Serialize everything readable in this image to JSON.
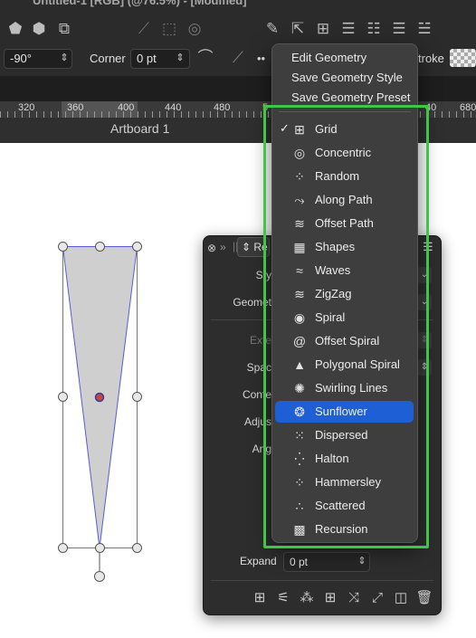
{
  "window": {
    "title": "Untitled-1 [RGB] (@76.5%) - [Modified]"
  },
  "toolbar": {
    "angle_value": "-90°",
    "corner_label": "Corner",
    "corner_value": "0 pt",
    "stroke_label": "troke",
    "more_label": "••"
  },
  "ruler": {
    "ticks": [
      "320",
      "360",
      "400",
      "440",
      "480",
      "5",
      "40",
      "680"
    ]
  },
  "artboard": {
    "label": "Artboard 1"
  },
  "menu": {
    "top_items": [
      "Edit Geometry",
      "Save Geometry Style",
      "Save Geometry Preset"
    ],
    "items": [
      {
        "label": "Grid",
        "icon": "grid-icon",
        "checked": true
      },
      {
        "label": "Concentric",
        "icon": "concentric-icon"
      },
      {
        "label": "Random",
        "icon": "random-icon"
      },
      {
        "label": "Along Path",
        "icon": "along-path-icon"
      },
      {
        "label": "Offset Path",
        "icon": "offset-path-icon"
      },
      {
        "label": "Shapes",
        "icon": "shapes-icon"
      },
      {
        "label": "Waves",
        "icon": "waves-icon"
      },
      {
        "label": "ZigZag",
        "icon": "zigzag-icon"
      },
      {
        "label": "Spiral",
        "icon": "spiral-icon"
      },
      {
        "label": "Offset Spiral",
        "icon": "offset-spiral-icon"
      },
      {
        "label": "Polygonal Spiral",
        "icon": "polygonal-spiral-icon"
      },
      {
        "label": "Swirling Lines",
        "icon": "swirling-lines-icon"
      },
      {
        "label": "Sunflower",
        "icon": "sunflower-icon",
        "selected": true
      },
      {
        "label": "Dispersed",
        "icon": "dispersed-icon"
      },
      {
        "label": "Halton",
        "icon": "halton-icon"
      },
      {
        "label": "Hammersley",
        "icon": "hammersley-icon"
      },
      {
        "label": "Scattered",
        "icon": "scattered-icon"
      },
      {
        "label": "Recursion",
        "icon": "recursion-icon"
      }
    ],
    "selected_color": "#1f5fd6"
  },
  "panel": {
    "tab_label": "Re",
    "labels": {
      "style": "Sty",
      "geometry": "Geomet",
      "extend": "Exte",
      "spacing": "Spac",
      "content": "Conte",
      "adjust": "Adjus",
      "angle": "Ang"
    },
    "expand_label": "Expand",
    "expand_value": "0 pt"
  },
  "highlight": {
    "color": "#3fc646"
  }
}
